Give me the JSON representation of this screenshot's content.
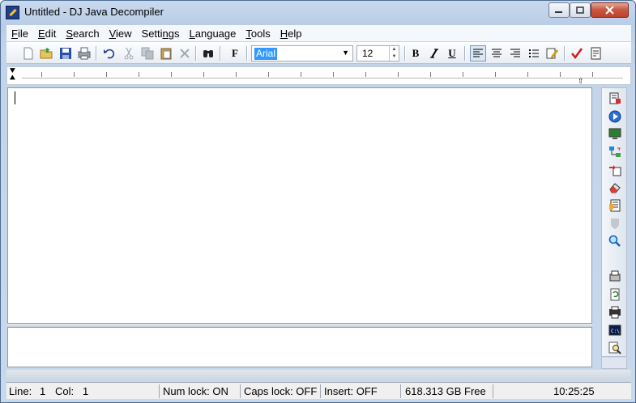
{
  "window": {
    "title": "Untitled - DJ Java Decompiler"
  },
  "caption_buttons": {
    "minimize": "▭",
    "maximize": "▢",
    "close": "✕"
  },
  "menu": [
    {
      "u": "F",
      "rest": "ile"
    },
    {
      "u": "E",
      "rest": "dit"
    },
    {
      "u": "S",
      "rest": "earch"
    },
    {
      "u": "V",
      "rest": "iew"
    },
    {
      "pre": "Setti",
      "u": "n",
      "rest": "gs"
    },
    {
      "u": "L",
      "rest": "anguage"
    },
    {
      "u": "T",
      "rest": "ools"
    },
    {
      "u": "H",
      "rest": "elp"
    }
  ],
  "toolbar": {
    "font": "Arial",
    "size": "12",
    "font_button": "F",
    "bold": "B",
    "italic": "I",
    "underline": "U",
    "colors": {
      "accent": "#3399ff",
      "check": "#d11a1a"
    }
  },
  "statusbar": {
    "line_label": "Line:",
    "line_value": "1",
    "col_label": "Col:",
    "col_value": "1",
    "num_lock": "Num lock: ON",
    "caps_lock": "Caps lock: OFF",
    "insert": "Insert: OFF",
    "free_space": "618.313 GB Free",
    "time": "10:25:25"
  }
}
